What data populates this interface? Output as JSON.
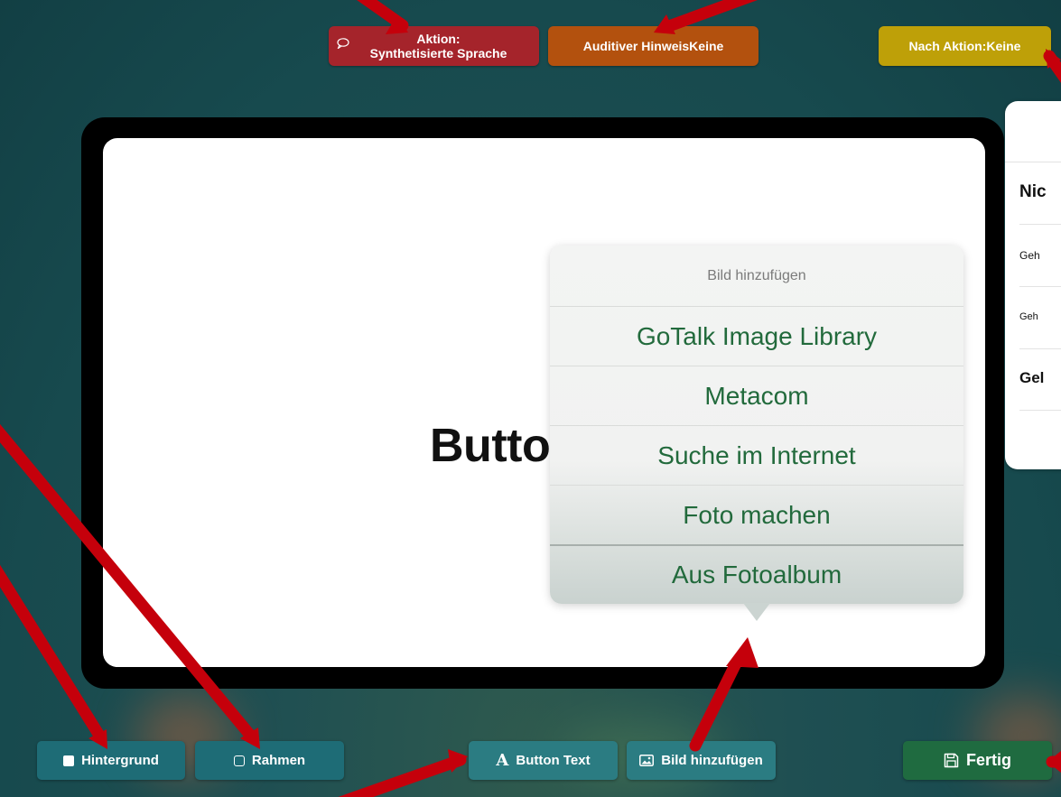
{
  "top": {
    "action_label": "Aktion:\nSynthetisierte Sprache",
    "hint_label": "Auditiver HinweisKeine",
    "after_label": "Nach Aktion:Keine"
  },
  "canvas": {
    "button_label": "Butto"
  },
  "side_sheet": {
    "rows": [
      "Nic",
      "Geh",
      "Geh",
      "Gel"
    ]
  },
  "popover": {
    "title": "Bild hinzufügen",
    "options": [
      "GoTalk Image Library",
      "Metacom",
      "Suche im Internet",
      "Foto machen",
      "Aus Fotoalbum"
    ]
  },
  "toolbar": {
    "background_label": "Hintergrund",
    "frame_label": "Rahmen",
    "button_text_label": "Button Text",
    "add_image_label": "Bild hinzufügen",
    "done_label": "Fertig"
  },
  "colors": {
    "action": "#a5242b",
    "hint": "#b3510e",
    "after": "#bea008",
    "toolbar": "#1e6c76",
    "done": "#1f6b40",
    "option_text": "#226a3c",
    "annotation": "#c5000b"
  }
}
